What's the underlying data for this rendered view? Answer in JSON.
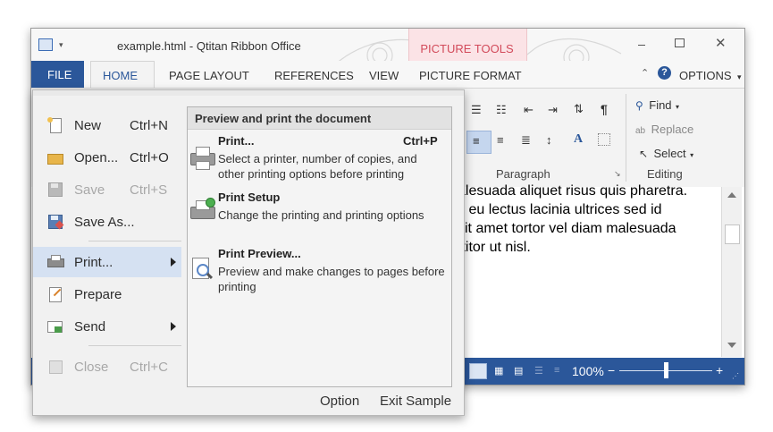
{
  "window": {
    "title": "example.html - Qtitan Ribbon Office",
    "context_group": "PICTURE TOOLS",
    "options_label": "OPTIONS",
    "help_glyph": "?"
  },
  "tabs": [
    "FILE",
    "HOME",
    "PAGE LAYOUT",
    "REFERENCES",
    "VIEW",
    "PICTURE FORMAT"
  ],
  "ribbon": {
    "paragraph_group": "Paragraph",
    "editing_group": "Editing",
    "find_label": "Find",
    "replace_label": "Replace",
    "select_label": "Select"
  },
  "document": {
    "lines": [
      "alesuada aliquet risus quis pharetra.",
      "s eu lectus lacinia ultrices sed id",
      "sit amet tortor vel diam malesuada",
      "ttitor ut nisl."
    ]
  },
  "status": {
    "zoom": "100%",
    "zoom_minus": "−",
    "zoom_plus": "+",
    "zoom_level_fraction": 0.5
  },
  "backstage": {
    "menu": [
      {
        "label": "New",
        "shortcut": "Ctrl+N",
        "disabled": false
      },
      {
        "label": "Open...",
        "shortcut": "Ctrl+O",
        "disabled": false
      },
      {
        "label": "Save",
        "shortcut": "Ctrl+S",
        "disabled": true
      },
      {
        "label": "Save As...",
        "shortcut": "",
        "disabled": false
      },
      {
        "label": "Print...",
        "shortcut": "",
        "disabled": false,
        "selected": true
      },
      {
        "label": "Prepare",
        "shortcut": "",
        "disabled": false
      },
      {
        "label": "Send",
        "shortcut": "",
        "disabled": false
      },
      {
        "label": "Close",
        "shortcut": "Ctrl+C",
        "disabled": true
      }
    ],
    "submenu_header": "Preview and print the document",
    "submenu": [
      {
        "title": "Print...",
        "shortcut": "Ctrl+P",
        "desc1": "Select a printer, number of copies, and",
        "desc2": "other printing options before printing"
      },
      {
        "title": "Print Setup",
        "shortcut": "",
        "desc1": "Change the printing and printing options",
        "desc2": ""
      },
      {
        "title": "Print Preview...",
        "shortcut": "",
        "desc1": "Preview and make changes to pages before",
        "desc2": "printing"
      }
    ],
    "footer_option": "Option",
    "footer_exit": "Exit Sample"
  },
  "colors": {
    "accent": "#2b579a",
    "context_tab": "#d24a5a",
    "selected_item": "#d5e1f2"
  }
}
